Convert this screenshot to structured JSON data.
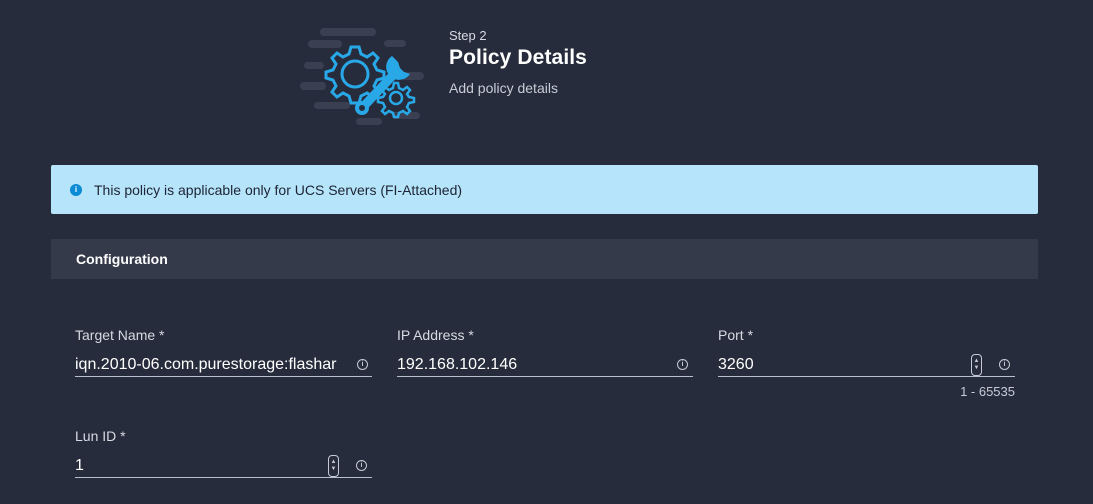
{
  "header": {
    "step_label": "Step 2",
    "title": "Policy Details",
    "subtitle": "Add policy details",
    "illustration_icon": "gear-wrench-icon"
  },
  "banner": {
    "icon": "info-icon",
    "text": "This policy is applicable only for UCS Servers (FI-Attached)",
    "color": "#b5e4fb"
  },
  "section": {
    "title": "Configuration"
  },
  "fields": {
    "target_name": {
      "label": "Target Name *",
      "value": "iqn.2010-06.com.purestorage:flashar"
    },
    "ip_address": {
      "label": "IP Address *",
      "value": "192.168.102.146"
    },
    "port": {
      "label": "Port *",
      "value": "3260",
      "range": "1 - 65535"
    },
    "lun_id": {
      "label": "Lun ID *",
      "value": "1"
    }
  },
  "colors": {
    "background": "#272c3c",
    "accent": "#29a8e8"
  }
}
